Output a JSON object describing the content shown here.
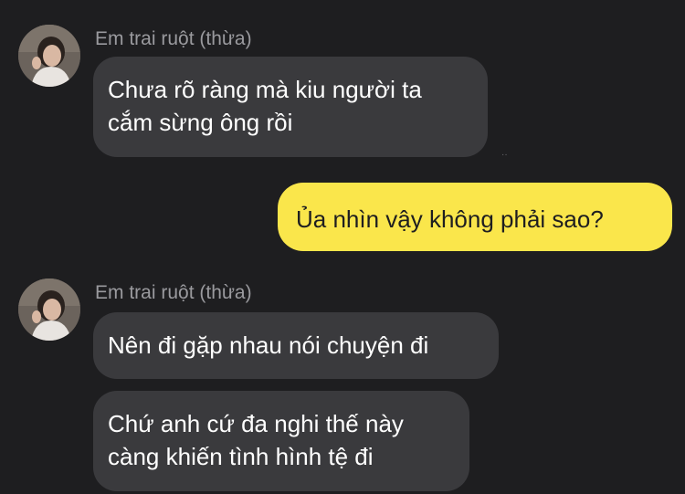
{
  "messages": [
    {
      "sender": "Em trai ruột (thừa)",
      "lines": [
        "Chưa rõ ràng mà kiu người ta",
        "cắm sừng ông rồi"
      ]
    },
    {
      "sender": "me",
      "lines": [
        "Ủa nhìn vậy không phải sao?"
      ]
    },
    {
      "sender": "Em trai ruột (thừa)",
      "lines": [
        "Nên đi gặp nhau nói chuyện đi"
      ]
    },
    {
      "sender": "Em trai ruột (thừa)",
      "lines": [
        "Chứ anh cứ đa nghi thế này",
        "càng khiến tình hình tệ đi"
      ]
    }
  ],
  "colors": {
    "background": "#1e1e20",
    "incoming_bubble": "#3a3a3d",
    "outgoing_bubble": "#fae64b",
    "sender_name": "#9a9a9e"
  }
}
